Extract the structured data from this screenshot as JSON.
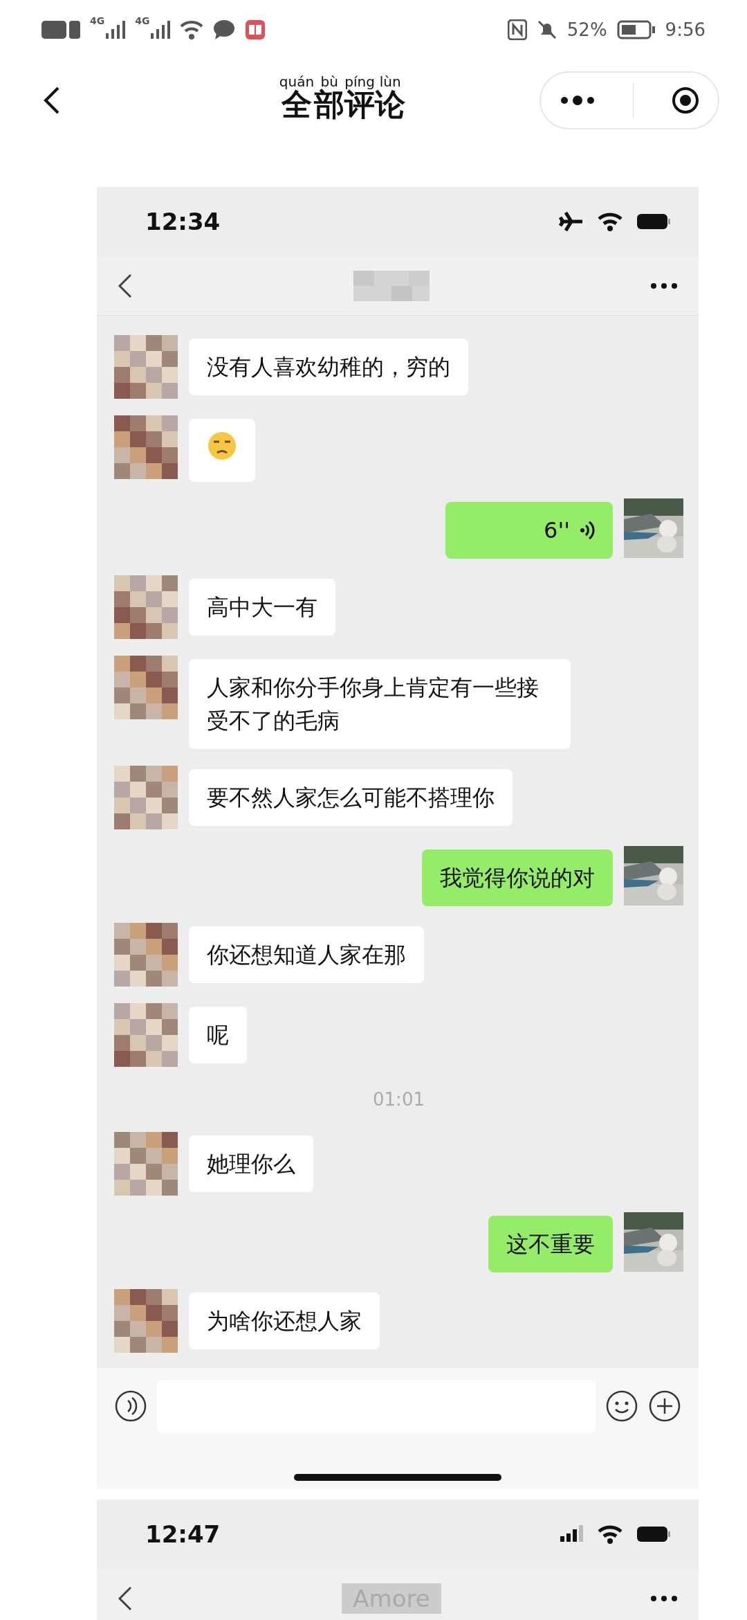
{
  "status_bar": {
    "time": "9:56",
    "battery": "52%",
    "networks": [
      "4G",
      "4G"
    ]
  },
  "header": {
    "title": [
      {
        "hanzi": "全",
        "pinyin": "quán"
      },
      {
        "hanzi": "部",
        "pinyin": "bù"
      },
      {
        "hanzi": "评",
        "pinyin": "píng"
      },
      {
        "hanzi": "论",
        "pinyin": "lùn"
      }
    ]
  },
  "screenshots": [
    {
      "status_time": "12:34",
      "messages": [
        {
          "kind": "received",
          "text": "没有人喜欢幼稚的，穷的"
        },
        {
          "kind": "emoji"
        },
        {
          "kind": "voice",
          "text": "6''"
        },
        {
          "kind": "received",
          "text": "高中大一有"
        },
        {
          "kind": "received",
          "text": "人家和你分手你身上肯定有一些接受不了的毛病"
        },
        {
          "kind": "received",
          "text": "要不然人家怎么可能不搭理你"
        },
        {
          "kind": "sent",
          "text": "我觉得你说的对"
        },
        {
          "kind": "received",
          "text": "你还想知道人家在那"
        },
        {
          "kind": "received",
          "text": "呢"
        },
        {
          "kind": "time",
          "text": "01:01"
        },
        {
          "kind": "received",
          "text": "她理你么"
        },
        {
          "kind": "sent",
          "text": "这不重要"
        },
        {
          "kind": "received",
          "text": "为啥你还想人家"
        }
      ]
    },
    {
      "status_time": "12:47",
      "chat_title": "Amore"
    }
  ]
}
